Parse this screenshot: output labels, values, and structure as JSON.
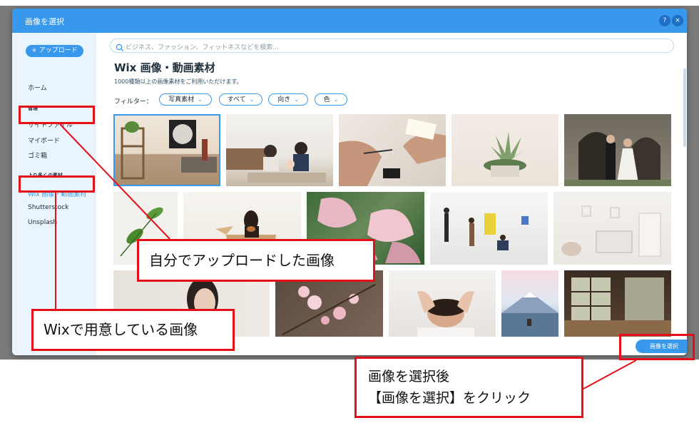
{
  "dialog": {
    "title": "画像を選択",
    "help_label": "?",
    "close_label": "×"
  },
  "sidebar": {
    "upload_label": "+ アップロード",
    "home": "ホーム",
    "manage_heading": "管理",
    "site_files": "サイトファイル",
    "my_board": "マイボード",
    "trash": "ゴミ箱",
    "more_heading": "より多くの素材",
    "wix_media": "Wix 画像・動画素材",
    "shutterstock": "Shutterstock",
    "unsplash": "Unsplash"
  },
  "search": {
    "placeholder": "ビジネス、ファッション、フィットネスなどを検索..."
  },
  "main": {
    "heading": "Wix 画像・動画素材",
    "subheading": "1000種類以上の画像素材をご利用いただけます。",
    "filter_label": "フィルター：",
    "filters": [
      "写真素材",
      "すべて",
      "向き",
      "色"
    ]
  },
  "gallery": {
    "images": [
      "interior-shelf-room",
      "family-living-room",
      "hands-writing-desk",
      "succulent-plant",
      "wedding-couple",
      "green-leaves",
      "dog-in-box",
      "pink-caladium-leaves",
      "art-gallery-people",
      "nursery-room",
      "woman-portrait",
      "cherry-blossoms",
      "facial-massage",
      "mount-fuji-lake",
      "japanese-room"
    ]
  },
  "footer": {
    "select_label": "画像を選択"
  },
  "annotations": {
    "uploaded_images": "自分でアップロードした画像",
    "wix_images": "Wixで用意している画像",
    "instruction_line1": "画像を選択後",
    "instruction_line2": "【画像を選択】をクリック"
  },
  "colors": {
    "accent": "#3899ec",
    "sidebar_bg": "#eaf4fd",
    "annotation_red": "#e3101a"
  }
}
